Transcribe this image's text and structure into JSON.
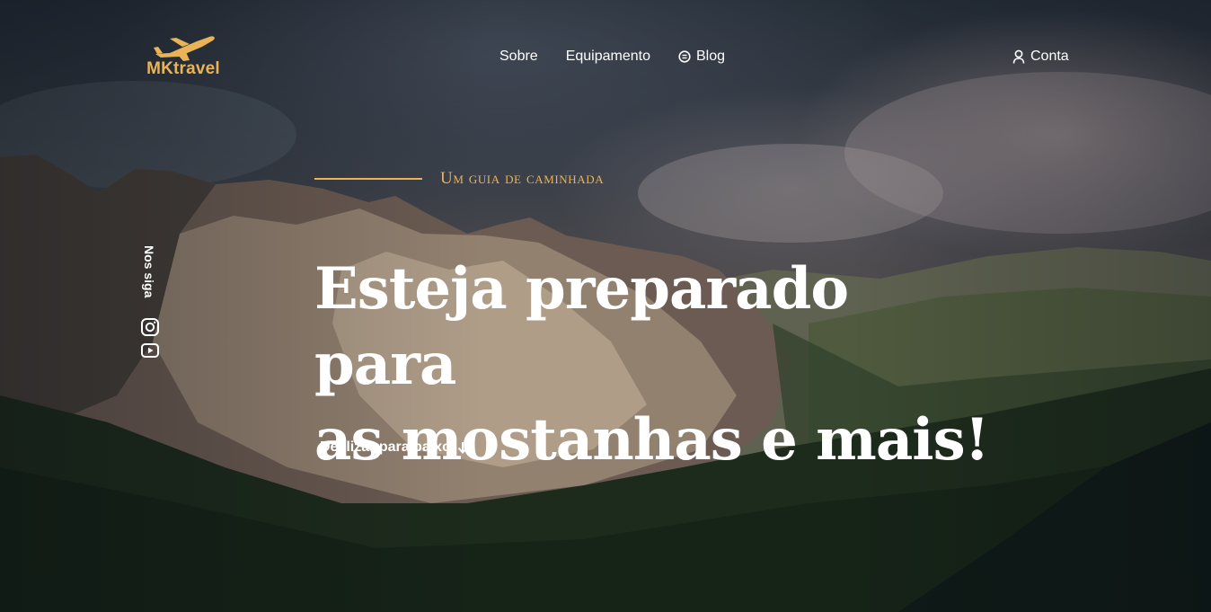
{
  "brand": {
    "name": "MKtravel",
    "color": "#e9b457"
  },
  "nav": {
    "items": [
      {
        "label": "Sobre"
      },
      {
        "label": "Equipamento"
      },
      {
        "label": "Blog",
        "icon": "blog-icon"
      }
    ],
    "account_label": "Conta",
    "account_icon": "user-icon"
  },
  "social": {
    "label": "Nos siga",
    "icons": [
      "instagram-icon",
      "youtube-icon"
    ]
  },
  "hero": {
    "subtitle": "Um guia de caminhada",
    "headline_line1": "Esteja preparado para",
    "headline_line2": "as mostanhas e mais!",
    "scroll_label": "Deslizar para baixo",
    "scroll_icon": "arrow-down-icon"
  }
}
